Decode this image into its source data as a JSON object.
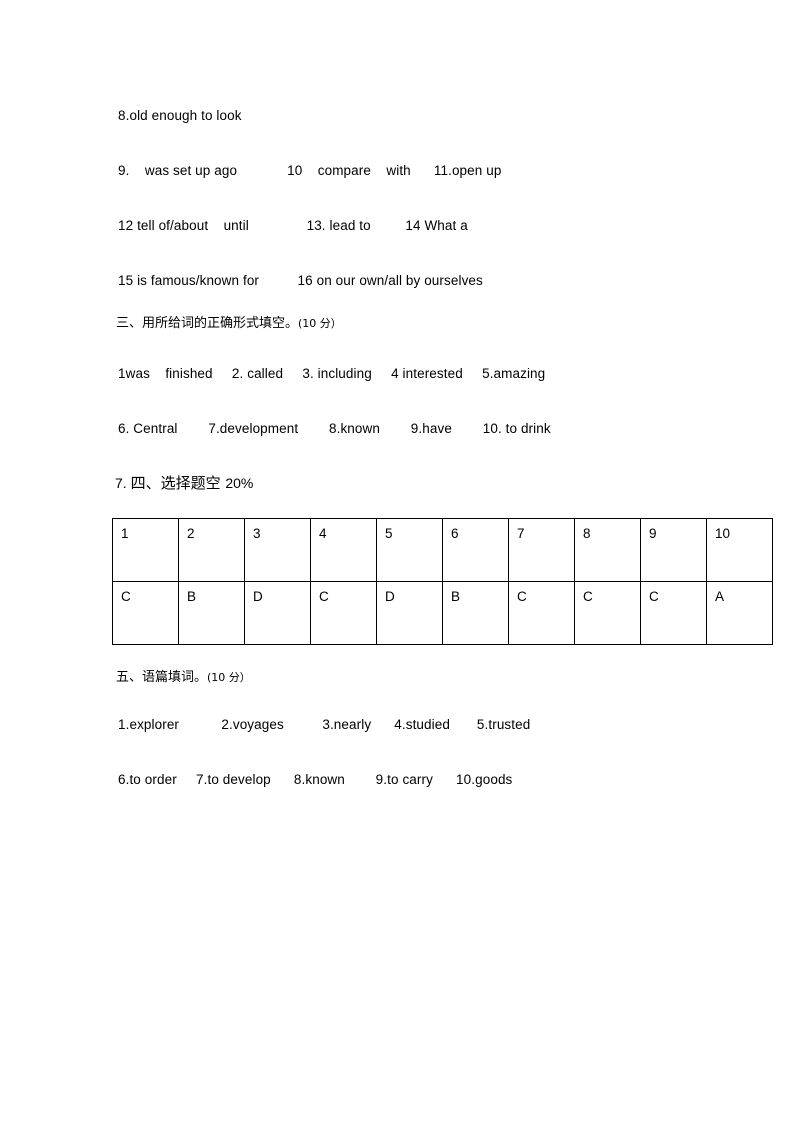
{
  "document": {
    "background_color": "#ffffff",
    "text_color": "#000000"
  },
  "answer_lines": {
    "line_8": "8.old enough to look",
    "line_9": "9.    was set up ago             10    compare    with      11.open up",
    "line_12": "12 tell of/about    until               13. lead to         14 What a",
    "line_15": "15 is famous/known for          16 on our own/all by ourselves"
  },
  "section_three": {
    "heading_cn": "三、用所给词的正确形式填空。",
    "heading_score": "(10 分）",
    "row_1": "1was    finished     2. called     3. including     4 interested     5.amazing",
    "row_2": "6. Central        7.development        8.known        9.have        10. to drink"
  },
  "section_four": {
    "prefix": "7. ",
    "heading_cn": "四、选择题空 ",
    "heading_score": "20%",
    "table": {
      "headers": [
        "1",
        "2",
        "3",
        "4",
        "5",
        "6",
        "7",
        "8",
        "9",
        "10"
      ],
      "answers": [
        "C",
        "B",
        "D",
        "C",
        "D",
        "B",
        "C",
        "C",
        "C",
        "A"
      ]
    }
  },
  "section_five": {
    "heading_cn": "五、语篇填词。",
    "heading_score": "(10 分）",
    "row_1": "1.explorer           2.voyages          3.nearly      4.studied       5.trusted",
    "row_2": "6.to order     7.to develop      8.known        9.to carry      10.goods"
  }
}
